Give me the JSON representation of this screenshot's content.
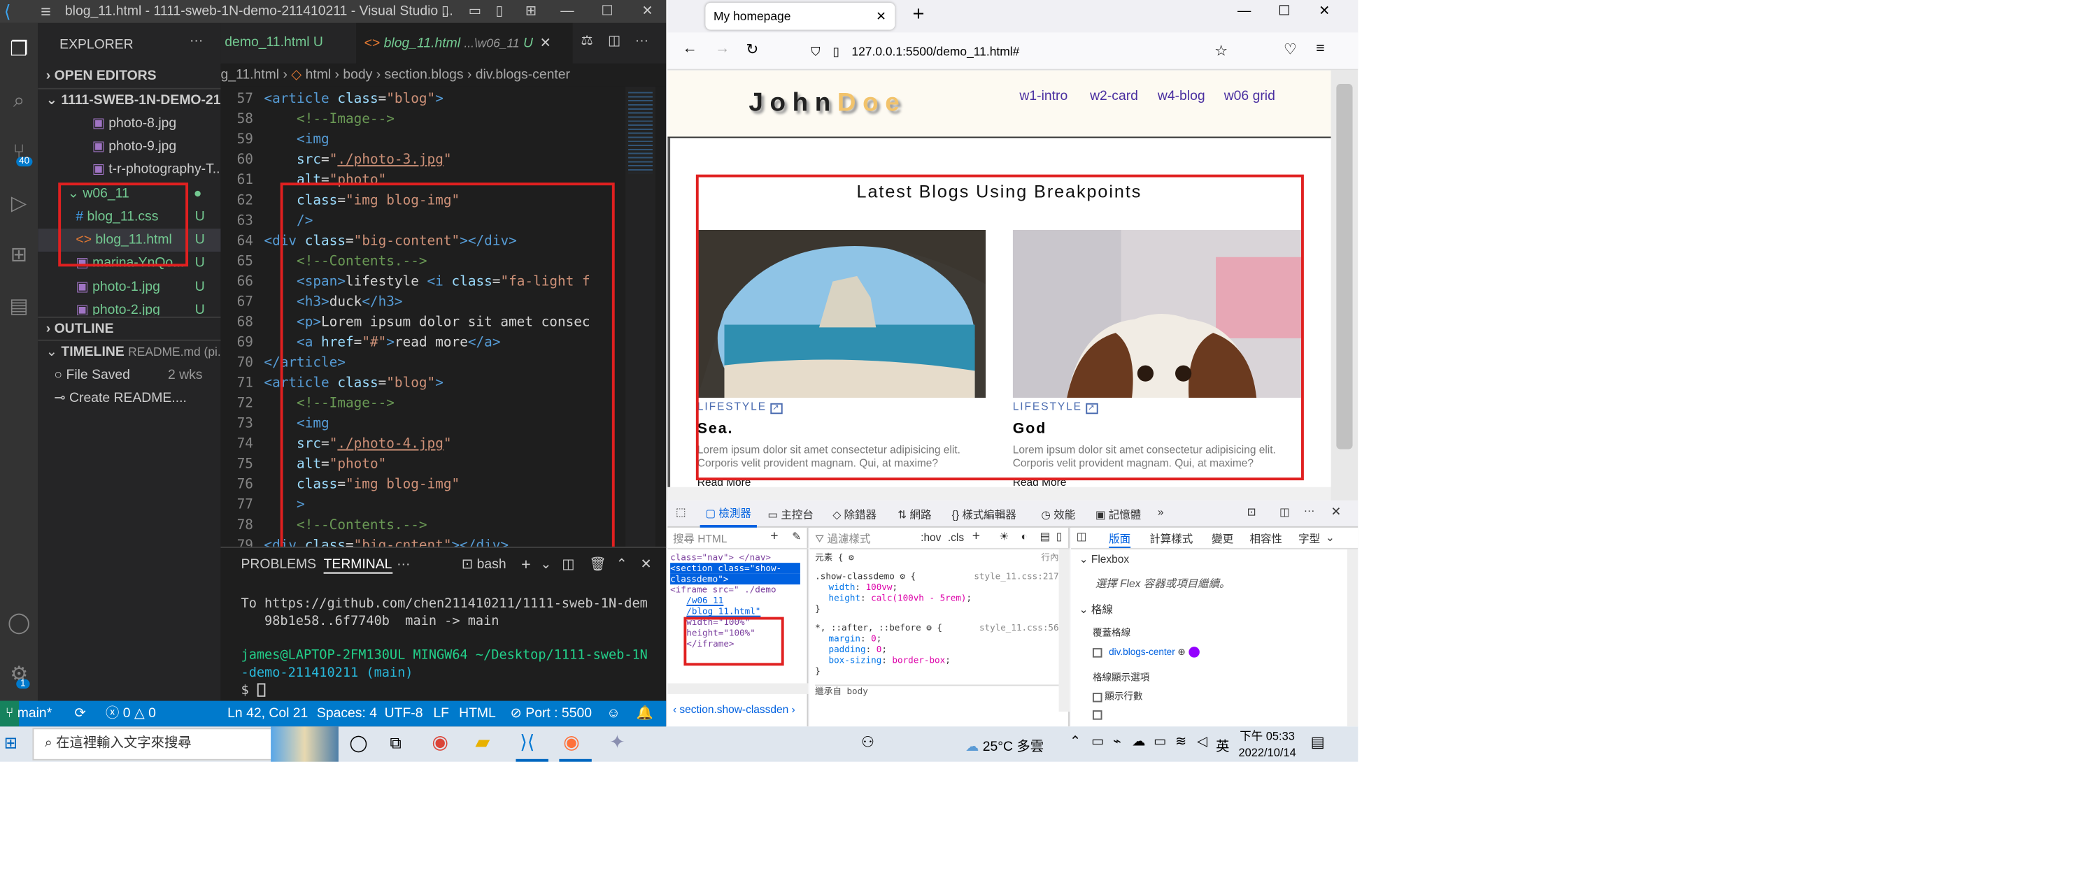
{
  "vscode": {
    "title": "blog_11.html - 1111-sweb-1N-demo-211410211 - Visual Studio ...",
    "sidebar": {
      "explorer_label": "EXPLORER",
      "open_editors": "OPEN EDITORS",
      "project": "1111-SWEB-1N-DEMO-21...",
      "files": [
        "photo-8.jpg",
        "photo-9.jpg",
        "t-r-photography-T..."
      ],
      "folder": "w06_11",
      "folder_files": [
        {
          "name": "blog_11.css",
          "badge": "U"
        },
        {
          "name": "blog_11.html",
          "badge": "U"
        },
        {
          "name": "marina-YnQo...",
          "badge": "U"
        },
        {
          "name": "photo-1.jpg",
          "badge": "U"
        },
        {
          "name": "photo-2.jpg",
          "badge": "U"
        }
      ],
      "outline": "OUTLINE",
      "timeline": "TIMELINE",
      "timeline_file": "README.md (pi...",
      "timeline_items": [
        {
          "label": "File Saved",
          "time": "2 wks"
        },
        {
          "label": "Create README....",
          "time": ""
        }
      ]
    },
    "tabs": [
      {
        "label": "demo_11.html",
        "badge": "U"
      },
      {
        "label": "blog_11.html",
        "path": "...\\w06_11",
        "badge": "U"
      }
    ],
    "breadcrumb": [
      "g_11.html",
      "html",
      "body",
      "section.blogs",
      "div.blogs-center"
    ],
    "code_lines": [
      {
        "n": "57",
        "html": "<span class='tg'>&lt;article</span> <span class='at'>class</span>=<span class='st'>\"blog\"</span><span class='tg'>&gt;</span>"
      },
      {
        "n": "58",
        "html": "    <span class='cm'>&lt;!--Image--&gt;</span>"
      },
      {
        "n": "59",
        "html": "    <span class='tg'>&lt;img</span>"
      },
      {
        "n": "60",
        "html": "    <span class='at'>src</span>=<span class='st'>\"<u>./photo-3.jpg</u>\"</span>"
      },
      {
        "n": "61",
        "html": "    <span class='at'>alt</span>=<span class='st'>\"photo\"</span>"
      },
      {
        "n": "62",
        "html": "    <span class='at'>class</span>=<span class='st'>\"img blog-img\"</span>"
      },
      {
        "n": "63",
        "html": "    <span class='tg'>/&gt;</span>"
      },
      {
        "n": "64",
        "html": "<span class='tg'>&lt;div</span> <span class='at'>class</span>=<span class='st'>\"big-content\"</span><span class='tg'>&gt;&lt;/div&gt;</span>"
      },
      {
        "n": "65",
        "html": "    <span class='cm'>&lt;!--Contents.--&gt;</span>"
      },
      {
        "n": "66",
        "html": "    <span class='tg'>&lt;span&gt;</span><span class='tx'>lifestyle </span><span class='tg'>&lt;i</span> <span class='at'>class</span>=<span class='st'>\"fa-light f</span>"
      },
      {
        "n": "67",
        "html": "    <span class='tg'>&lt;h3&gt;</span><span class='tx'>duck</span><span class='tg'>&lt;/h3&gt;</span>"
      },
      {
        "n": "68",
        "html": "    <span class='tg'>&lt;p&gt;</span><span class='tx'>Lorem ipsum dolor sit amet consec</span>"
      },
      {
        "n": "69",
        "html": "    <span class='tg'>&lt;a</span> <span class='at'>href</span>=<span class='st'>\"#\"</span><span class='tg'>&gt;</span><span class='tx'>read more</span><span class='tg'>&lt;/a&gt;</span>"
      },
      {
        "n": "70",
        "html": "<span class='tg'>&lt;/article&gt;</span>"
      },
      {
        "n": "71",
        "html": "<span class='tg'>&lt;article</span> <span class='at'>class</span>=<span class='st'>\"blog\"</span><span class='tg'>&gt;</span>"
      },
      {
        "n": "72",
        "html": "    <span class='cm'>&lt;!--Image--&gt;</span>"
      },
      {
        "n": "73",
        "html": "    <span class='tg'>&lt;img</span>"
      },
      {
        "n": "74",
        "html": "    <span class='at'>src</span>=<span class='st'>\"<u>./photo-4.jpg</u>\"</span>"
      },
      {
        "n": "75",
        "html": "    <span class='at'>alt</span>=<span class='st'>\"photo\"</span>"
      },
      {
        "n": "76",
        "html": "    <span class='at'>class</span>=<span class='st'>\"img blog-img\"</span>"
      },
      {
        "n": "77",
        "html": "    <span class='tg'>&gt;</span>"
      },
      {
        "n": "78",
        "html": "    <span class='cm'>&lt;!--Contents.--&gt;</span>"
      },
      {
        "n": "79",
        "html": "<span class='tg'>&lt;div</span> <span class='at'>class</span>=<span class='st'>\"big-cntent\"</span><span class='tg'>&gt;&lt;/div&gt;</span>"
      }
    ],
    "panel_tabs": [
      "PROBLEMS",
      "TERMINAL",
      "···"
    ],
    "shell": "bash",
    "terminal_lines": [
      {
        "text": "To https://github.com/chen211410211/1111-sweb-1N-dem",
        "color": "#cccccc"
      },
      {
        "text": "   98b1e58..6f7740b  main -> main",
        "color": "#cccccc"
      },
      {
        "text": "",
        "color": "#cccccc"
      },
      {
        "text": "james@LAPTOP-2FM130UL MINGW64 ~/Desktop/1111-sweb-1N",
        "color": "#23d18b"
      },
      {
        "text": "-demo-211410211 (main)",
        "color": "#29b8db"
      },
      {
        "text": "$ ",
        "color": "#cccccc"
      }
    ],
    "status": {
      "branch": "main*",
      "errors": "0",
      "warnings": "0",
      "position": "Ln 42, Col 21",
      "spaces": "Spaces: 4",
      "encoding": "UTF-8",
      "eol": "LF",
      "language": "HTML",
      "port": "Port : 5500"
    }
  },
  "browser": {
    "tab_title": "My homepage",
    "url": "127.0.0.1:5500/demo_11.html#",
    "page": {
      "logo": "JohnDoe",
      "nav": [
        "w1-intro",
        "w2-card",
        "w4-blog",
        "w06 grid"
      ],
      "section_title": "Latest Blogs Using Breakpoints",
      "cards": [
        {
          "tag": "LIFESTYLE",
          "title": "Sea.",
          "text": "Lorem ipsum dolor sit amet consectetur adipisicing elit. Corporis velit provident magnam. Qui, at maxime?",
          "link": "Read More"
        },
        {
          "tag": "LIFESTYLE",
          "title": "God",
          "text": "Lorem ipsum dolor sit amet consectetur adipisicing elit. Corporis velit provident magnam. Qui, at maxime?",
          "link": "Read More"
        }
      ]
    },
    "devtools": {
      "tabs": [
        "檢測器",
        "主控台",
        "除錯器",
        "網路",
        "樣式編輯器",
        "效能",
        "記憶體"
      ],
      "search_html": "搜尋 HTML",
      "filter_styles": "過濾樣式",
      "hov": ":hov",
      "cls": ".cls",
      "layout_tabs": [
        "版面",
        "計算樣式",
        "變更",
        "相容性",
        "字型"
      ],
      "flexbox": "Flexbox",
      "flex_hint": "選擇 Flex 容器或項目繼續。",
      "grid": "格線",
      "overlay_grid": "覆蓋格線",
      "grid_item": "div.blogs-center",
      "grid_display": "格線顯示選項",
      "show_line_numbers": "顯示行數",
      "breadcrumb": "section.show-classden",
      "inherit": "繼承自 body",
      "element_label": "元素 {",
      "inline": "行內",
      "html_tree": [
        "class=\"nav\"> </nav>",
        "<section class=\"show-",
        "classdemo\">",
        "<iframe src=\" ./demo",
        "/w06_11",
        "/blog_11.html\"",
        "width=\"100%\"",
        "height=\"100%\"",
        "</iframe>"
      ],
      "rules": [
        {
          "selector": ".show-classdemo",
          "file": "style_11.css:217",
          "props": [
            [
              "width",
              "100vw"
            ],
            [
              "height",
              "calc(100vh - 5rem)"
            ]
          ]
        },
        {
          "selector": "*, ::after, ::before",
          "file": "style_11.css:56",
          "props": [
            [
              "margin",
              "0"
            ],
            [
              "padding",
              "0"
            ],
            [
              "box-sizing",
              "border-box"
            ]
          ]
        }
      ]
    }
  },
  "taskbar": {
    "search": "在這裡輸入文字來搜尋",
    "weather": "25°C 多雲",
    "ime": "英",
    "time": "下午 05:33",
    "date": "2022/10/14"
  }
}
